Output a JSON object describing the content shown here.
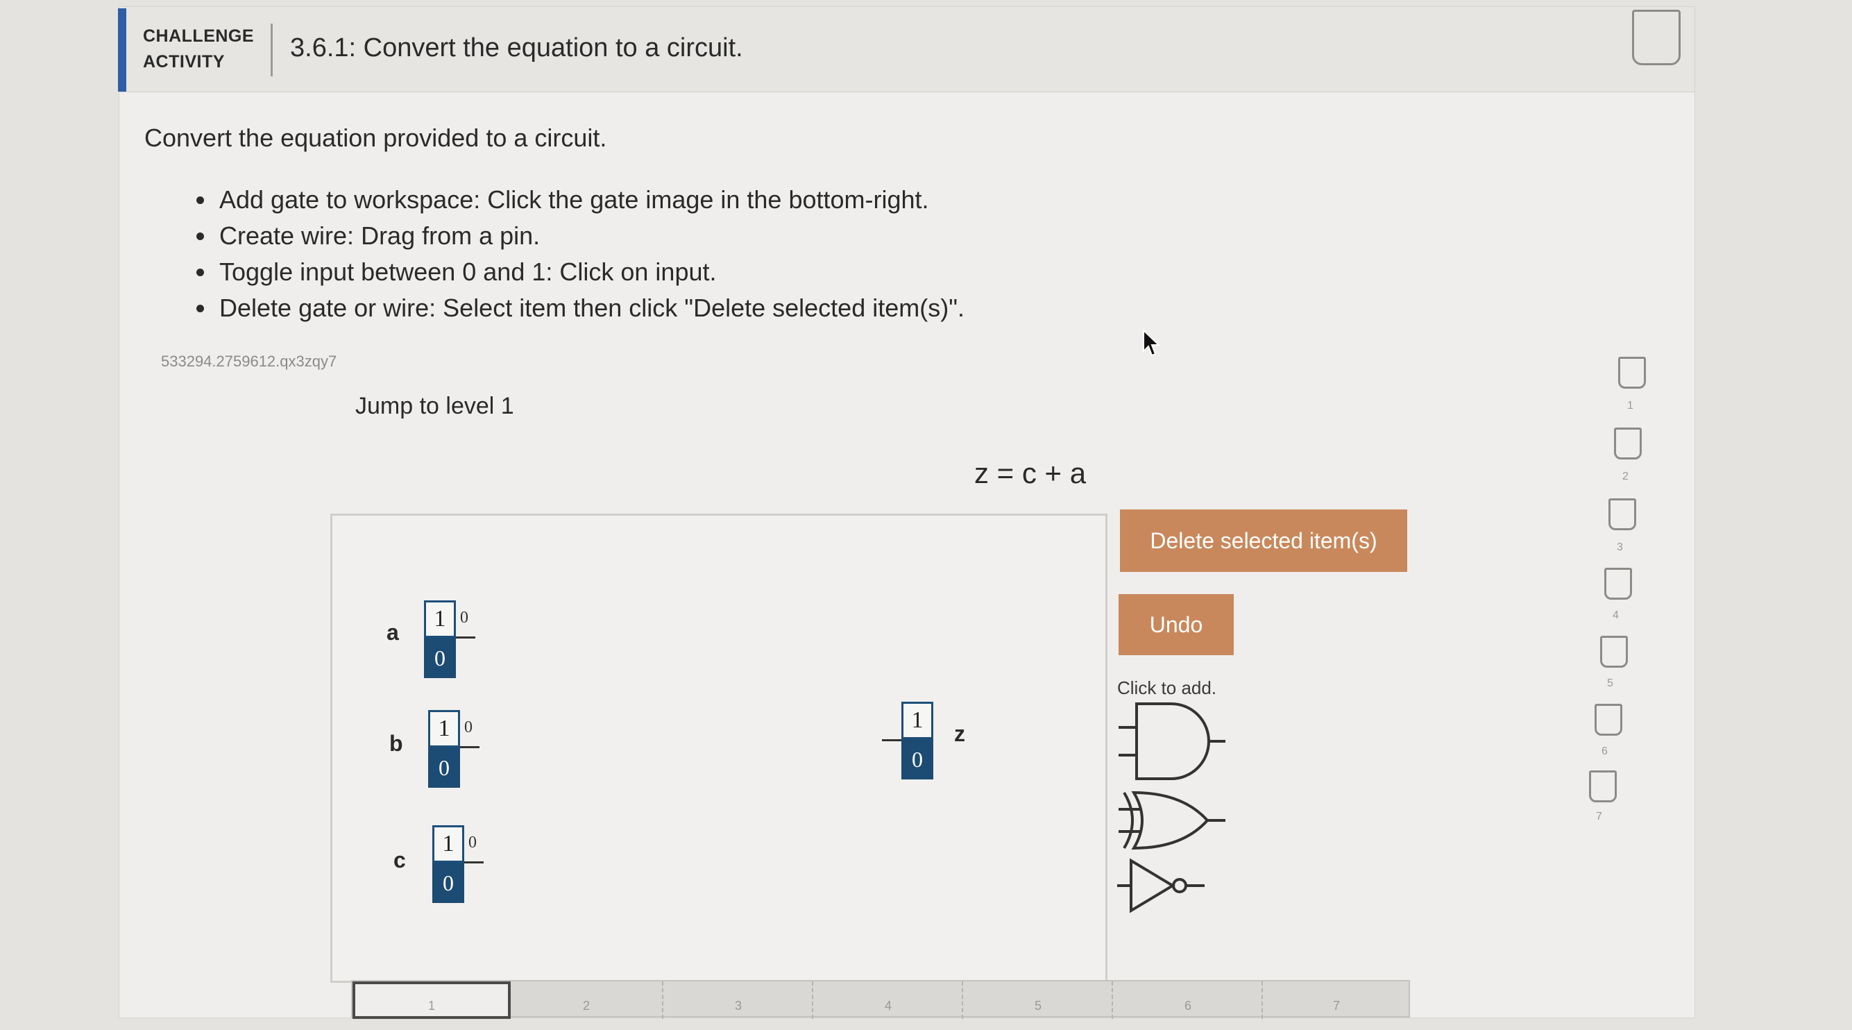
{
  "header": {
    "label_line1": "CHALLENGE",
    "label_line2": "ACTIVITY",
    "title": "3.6.1: Convert the equation to a circuit."
  },
  "instructions": {
    "intro": "Convert the equation provided to a circuit.",
    "bullets": [
      "Add gate to workspace: Click the gate image in the bottom-right.",
      "Create wire: Drag from a pin.",
      "Toggle input between 0 and 1: Click on input.",
      "Delete gate or wire: Select item then click \"Delete selected item(s)\"."
    ]
  },
  "activity_id": "533294.2759612.qx3zqy7",
  "jump_link": "Jump to level 1",
  "equation": "z = c + a",
  "workspace": {
    "inputs": [
      {
        "name": "a",
        "opt1": "1",
        "opt0": "0",
        "value": "0"
      },
      {
        "name": "b",
        "opt1": "1",
        "opt0": "0",
        "value": "0"
      },
      {
        "name": "c",
        "opt1": "1",
        "opt0": "0",
        "value": "0"
      }
    ],
    "output": {
      "name": "z",
      "opt1": "1",
      "opt0": "0"
    }
  },
  "buttons": {
    "delete": "Delete selected item(s)",
    "undo": "Undo"
  },
  "gates_palette": {
    "label": "Click to add.",
    "gates": [
      "and-gate-icon",
      "or-gate-icon",
      "not-gate-icon"
    ]
  },
  "progress_tracker": [
    "1",
    "2",
    "3",
    "4",
    "5",
    "6",
    "7"
  ],
  "level_tabs": [
    "1",
    "2",
    "3",
    "4",
    "5",
    "6",
    "7"
  ],
  "colors": {
    "accent": "#2f5da6",
    "button": "#c9885b",
    "toggle_dark": "#1c4b73"
  }
}
